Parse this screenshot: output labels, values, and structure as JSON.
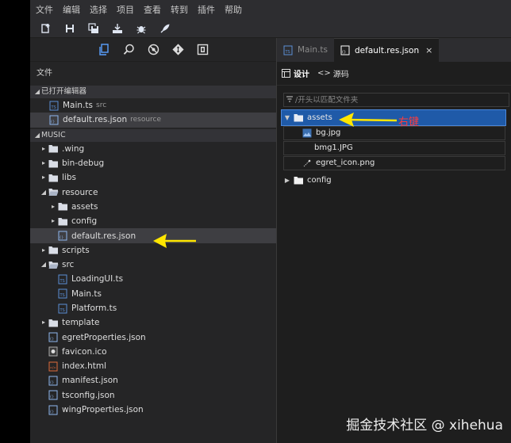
{
  "menubar": [
    "文件",
    "编辑",
    "选择",
    "项目",
    "查看",
    "转到",
    "插件",
    "帮助"
  ],
  "toolbar": [
    "new-file-icon",
    "save-icon",
    "save-all-icon",
    "publish-icon",
    "debug-icon",
    "launch-icon"
  ],
  "left_panel": {
    "icons": [
      "files-icon",
      "search-icon",
      "no-bug-icon",
      "git-icon",
      "extensions-icon"
    ],
    "title": "文件",
    "open_editors": {
      "label": "已打开编辑器",
      "items": [
        {
          "label": "Main.ts",
          "desc": "src",
          "type": "ts"
        },
        {
          "label": "default.res.json",
          "desc": "resource",
          "type": "json",
          "selected": true
        }
      ]
    },
    "project": {
      "label": "MUSIC",
      "items": [
        {
          "label": ".wing",
          "type": "folder",
          "level": 1,
          "arrow": "right"
        },
        {
          "label": "bin-debug",
          "type": "folder",
          "level": 1,
          "arrow": "right"
        },
        {
          "label": "libs",
          "type": "folder",
          "level": 1,
          "arrow": "right"
        },
        {
          "label": "resource",
          "type": "folder-open",
          "level": 1,
          "arrow": "down"
        },
        {
          "label": "assets",
          "type": "folder",
          "level": 2,
          "arrow": "right"
        },
        {
          "label": "config",
          "type": "folder",
          "level": 2,
          "arrow": "right"
        },
        {
          "label": "default.res.json",
          "type": "json",
          "level": 2,
          "arrow": "",
          "selected": true
        },
        {
          "label": "scripts",
          "type": "folder",
          "level": 1,
          "arrow": "right"
        },
        {
          "label": "src",
          "type": "folder-open",
          "level": 1,
          "arrow": "down"
        },
        {
          "label": "LoadingUI.ts",
          "type": "ts",
          "level": 2,
          "arrow": ""
        },
        {
          "label": "Main.ts",
          "type": "ts",
          "level": 2,
          "arrow": ""
        },
        {
          "label": "Platform.ts",
          "type": "ts",
          "level": 2,
          "arrow": ""
        },
        {
          "label": "template",
          "type": "folder",
          "level": 1,
          "arrow": "right"
        },
        {
          "label": "egretProperties.json",
          "type": "json",
          "level": 1,
          "arrow": ""
        },
        {
          "label": "favicon.ico",
          "type": "ico",
          "level": 1,
          "arrow": ""
        },
        {
          "label": "index.html",
          "type": "html",
          "level": 1,
          "arrow": ""
        },
        {
          "label": "manifest.json",
          "type": "json",
          "level": 1,
          "arrow": ""
        },
        {
          "label": "tsconfig.json",
          "type": "json",
          "level": 1,
          "arrow": ""
        },
        {
          "label": "wingProperties.json",
          "type": "json",
          "level": 1,
          "arrow": ""
        }
      ]
    }
  },
  "right_panel": {
    "tabs": [
      {
        "label": "Main.ts",
        "active": false
      },
      {
        "label": "default.res.json",
        "active": true,
        "close": "×"
      }
    ],
    "modes": [
      {
        "label": "设计",
        "active": true
      },
      {
        "label": "源码",
        "active": false
      }
    ],
    "search_placeholder": "/开头以匹配文件夹",
    "tree": [
      {
        "label": "assets",
        "type": "folder-open",
        "selected": true
      },
      {
        "label": "bg.jpg",
        "type": "image"
      },
      {
        "label": "bmg1.JPG",
        "type": "image-none"
      },
      {
        "label": "egret_icon.png",
        "type": "image-small"
      },
      {
        "label": "config",
        "type": "folder"
      }
    ]
  },
  "annotation": {
    "text": "右键",
    "color": "#ff3b3b",
    "arrow_color": "#ffe600"
  },
  "watermark": "掘金技术社区 @ xihehua",
  "colors": {
    "accent": "#1f5aa8",
    "folder": "#d9dde6",
    "ts": "#5a8fd6"
  }
}
